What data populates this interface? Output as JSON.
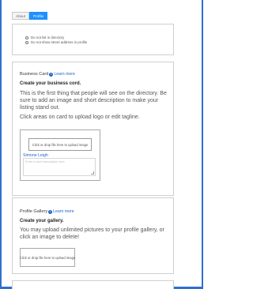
{
  "tabs": [
    {
      "label": "About",
      "active": false
    },
    {
      "label": "Profile",
      "active": true
    }
  ],
  "privacy": {
    "options": [
      {
        "label": "Do not list in directory"
      },
      {
        "label": "Do not show street address in profile"
      }
    ]
  },
  "business_card": {
    "heading": "Business Card",
    "info_icon": "info-circle-icon",
    "learn_more": "Learn more",
    "title": "Create your business cord.",
    "description": "This is the first thing that people will see on the directory. Be sure to add an image and short description to make your listing stand out.",
    "hint": "Click areas on card to upload logo or edit tagline.",
    "upload_label": "Click or drop file here to upload image",
    "name": "Simone Leigh",
    "tagline_placeholder": "Enter a short description here"
  },
  "gallery": {
    "heading": "Profile Gallery",
    "info_icon": "info-circle-icon",
    "learn_more": "Learn more",
    "title": "Create your gallery.",
    "description": "You may upload unlimited pictures to your profile gallery, or click an image to delete!",
    "upload_label": "Click or drop file here to upload image"
  },
  "colors": {
    "accent": "#1e90ff",
    "link": "#1e63c8",
    "frame": "#2f6fd0"
  }
}
